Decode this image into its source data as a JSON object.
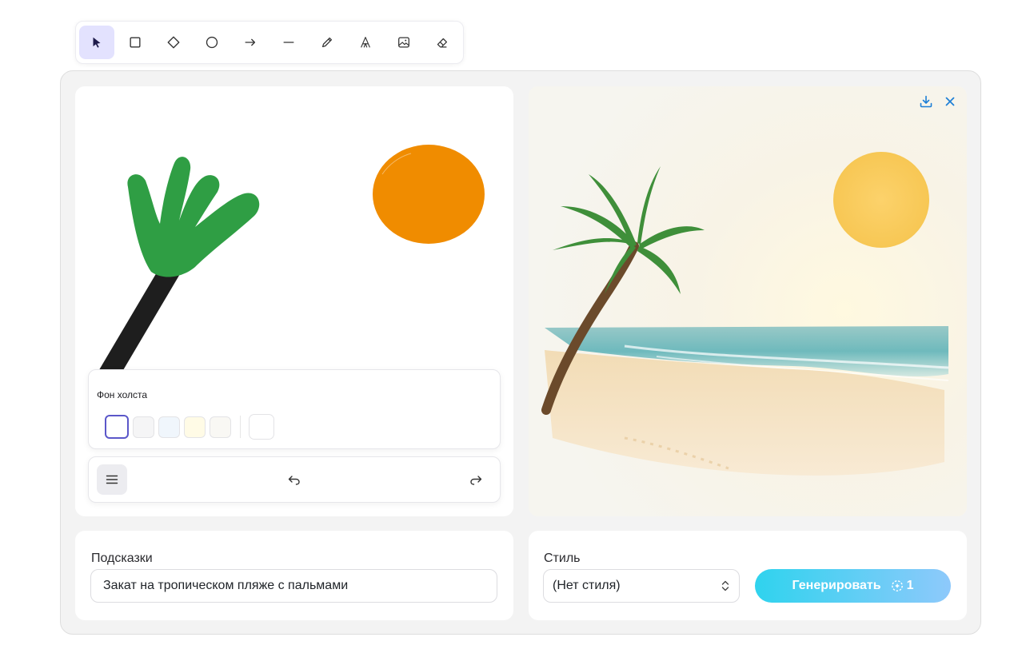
{
  "toolbar": {
    "tools": [
      {
        "name": "select",
        "icon": "cursor-arrow-icon",
        "active": true
      },
      {
        "name": "rectangle",
        "icon": "square-icon"
      },
      {
        "name": "diamond",
        "icon": "diamond-icon"
      },
      {
        "name": "ellipse",
        "icon": "circle-icon"
      },
      {
        "name": "arrow",
        "icon": "arrow-right-icon"
      },
      {
        "name": "line",
        "icon": "line-icon"
      },
      {
        "name": "draw",
        "icon": "pencil-icon"
      },
      {
        "name": "text",
        "icon": "text-icon"
      },
      {
        "name": "image",
        "icon": "image-icon"
      },
      {
        "name": "eraser",
        "icon": "eraser-icon"
      }
    ],
    "active_color": "#e3e2fe"
  },
  "canvas": {
    "background_popover": {
      "title": "Фон холста",
      "swatches": [
        "#ffffff",
        "#f8f9fa",
        "#f5faff",
        "#fffce8",
        "#fdf8f6"
      ],
      "selected_index": 0,
      "custom_color": "#ffffff"
    },
    "footer": {
      "menu_icon": "hamburger-menu-icon",
      "undo_icon": "undo-icon",
      "redo_icon": "redo-icon"
    },
    "drawing_colors": {
      "leaves": "#2f9e44",
      "trunk": "#1e1e1e",
      "sun": "#f08c00"
    }
  },
  "result": {
    "download_icon": "download-icon",
    "close_icon": "close-icon",
    "accent_color": "#1c7ed6"
  },
  "prompt": {
    "label": "Подсказки",
    "value": "Закат на тропическом пляже с пальмами"
  },
  "style": {
    "label": "Стиль",
    "selected": "(Нет стиля)",
    "generate_label": "Генерировать",
    "credits": "1",
    "button_gradient": [
      "#2fd3ee",
      "#8ec9fb"
    ]
  }
}
